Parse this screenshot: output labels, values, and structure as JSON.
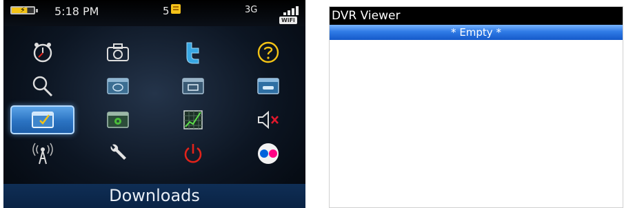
{
  "phone": {
    "status_bar": {
      "time": "5:18 PM",
      "notification_count": "5",
      "network_type": "3G",
      "wifi_badge": "WiFi"
    },
    "icons": [
      {
        "name": "clock-icon"
      },
      {
        "name": "camera-icon"
      },
      {
        "name": "twitter-icon"
      },
      {
        "name": "help-icon"
      },
      {
        "name": "search-icon"
      },
      {
        "name": "messages-folder-icon"
      },
      {
        "name": "folder-icon"
      },
      {
        "name": "media-folder-icon"
      },
      {
        "name": "downloads-folder-icon"
      },
      {
        "name": "settings-folder-icon"
      },
      {
        "name": "chart-icon"
      },
      {
        "name": "mute-icon"
      },
      {
        "name": "manage-connections-icon"
      },
      {
        "name": "wrench-icon"
      },
      {
        "name": "power-icon"
      },
      {
        "name": "flickr-icon"
      }
    ],
    "selected_label": "Downloads"
  },
  "dvr_viewer": {
    "title": "DVR Viewer",
    "list_item": "* Empty *"
  },
  "colors": {
    "selected_tile": "#2b73c2",
    "twitter": "#38a7e3",
    "help": "#f3c316",
    "power": "#e2231a",
    "mute_x": "#e0182c",
    "flickr_blue": "#0063dc",
    "flickr_pink": "#ff0084",
    "list_highlight": "#2f7be6"
  }
}
